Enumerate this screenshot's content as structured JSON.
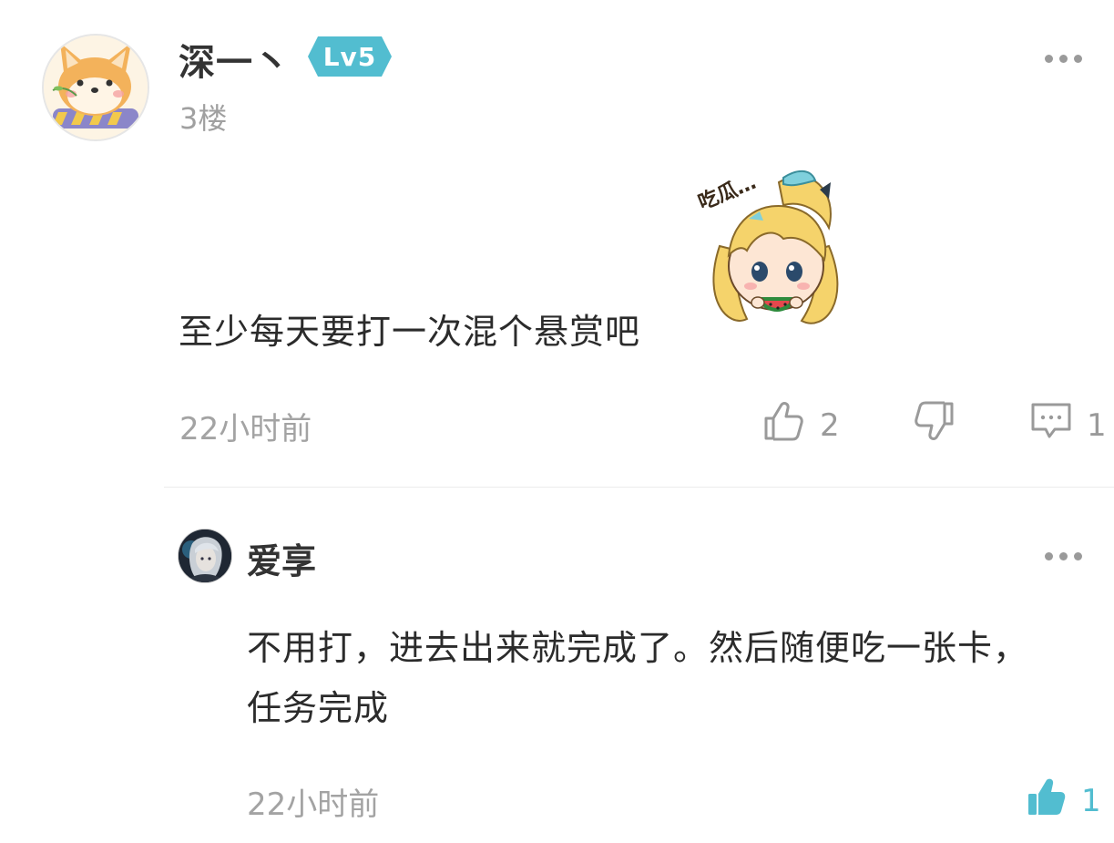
{
  "comment": {
    "username": "深一丶",
    "level": "Lv5",
    "floor": "3楼",
    "text": "至少每天要打一次混个悬赏吧",
    "sticker_caption": "吃瓜…",
    "time": "22小时前",
    "likes": "2",
    "replies": "1"
  },
  "reply": {
    "username": "爱享",
    "text": "不用打，进去出来就完成了。然后随便吃一张卡，任务完成",
    "time": "22小时前",
    "likes": "1"
  },
  "colors": {
    "accent": "#52bdd0",
    "muted": "#a3a3a3"
  }
}
